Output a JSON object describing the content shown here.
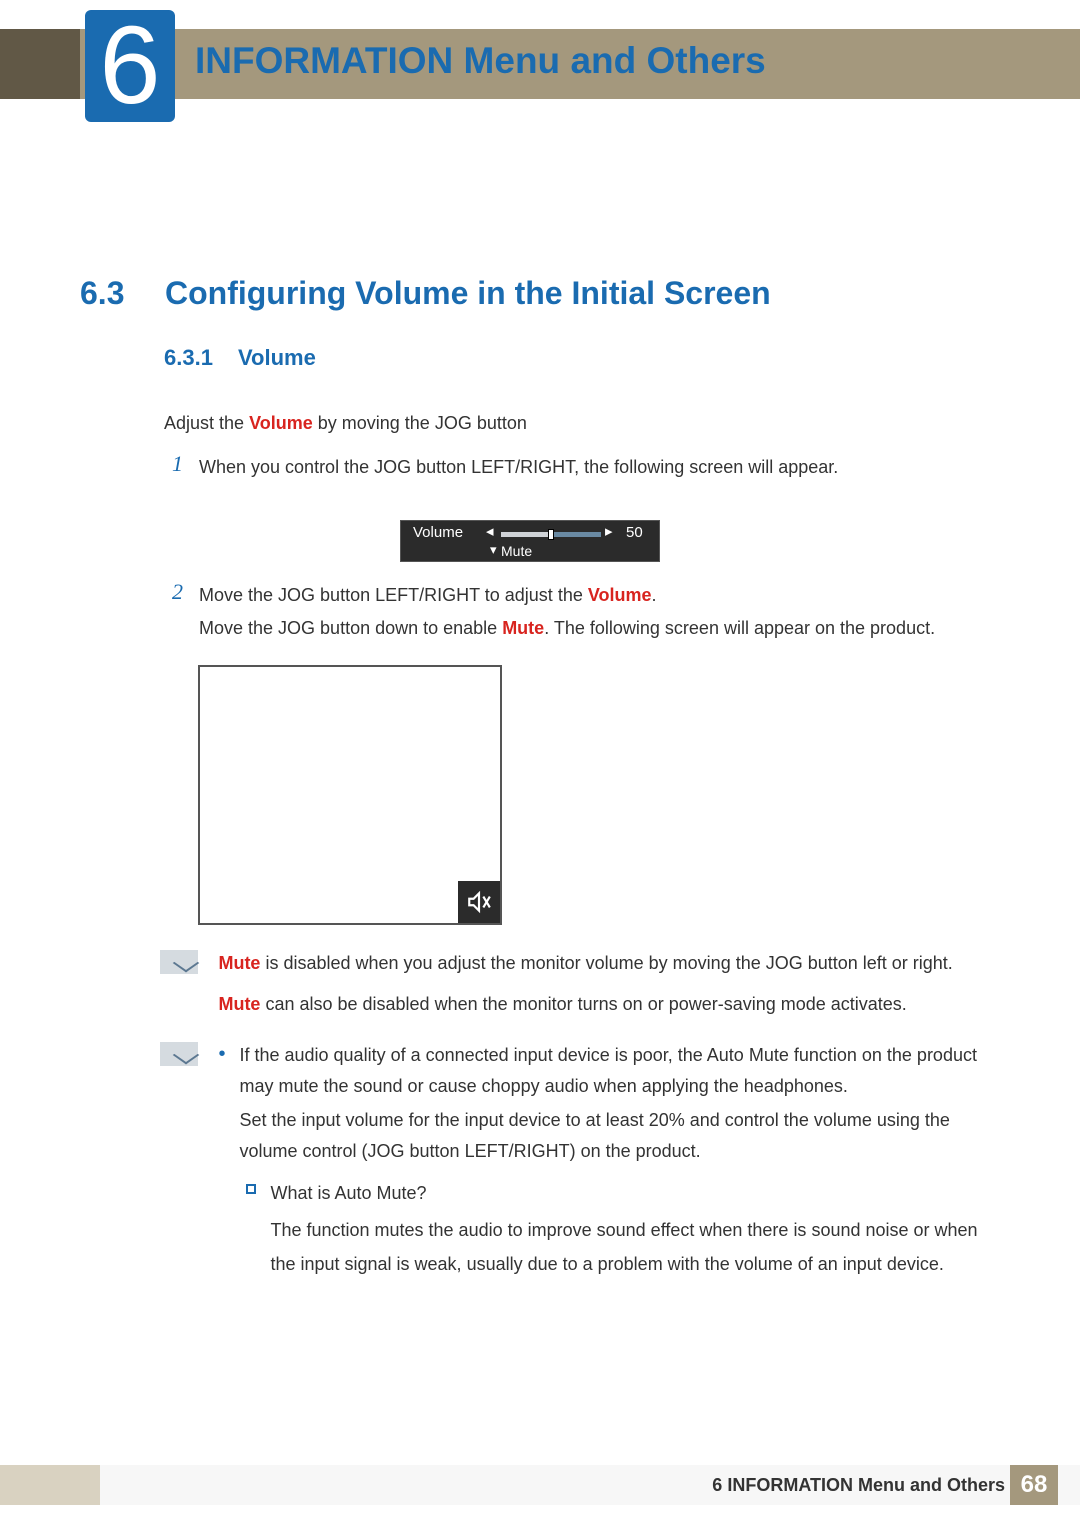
{
  "header": {
    "chapter_number": "6",
    "chapter_title": "INFORMATION Menu and Others"
  },
  "section": {
    "number": "6.3",
    "title": "Configuring Volume in the Initial Screen"
  },
  "subsection": {
    "number": "6.3.1",
    "title": "Volume"
  },
  "intro": {
    "prefix": "Adjust the ",
    "bold": "Volume",
    "suffix": " by moving the JOG button"
  },
  "steps": {
    "s1_num": "1",
    "s1_text": "When you control the JOG button LEFT/RIGHT, the following screen will appear.",
    "s2_num": "2",
    "s2a_prefix": "Move the JOG button LEFT/RIGHT to adjust the ",
    "s2a_bold": "Volume",
    "s2a_suffix": ".",
    "s2b_prefix": "Move the JOG button down to enable ",
    "s2b_bold": "Mute",
    "s2b_suffix": ". The following screen will appear on the product."
  },
  "volume_osd": {
    "label": "Volume",
    "value": "50",
    "mute_label": "Mute"
  },
  "note1": {
    "line1_bold": "Mute",
    "line1_rest": " is disabled when you adjust the monitor volume by moving the JOG button left or right.",
    "line2_bold": "Mute",
    "line2_rest": " can also be disabled when the monitor turns on or power-saving mode activates."
  },
  "note2": {
    "b1a": "If the audio quality of a connected input device is poor, the Auto Mute function on the product may mute the sound or cause choppy audio when applying the headphones.",
    "b1b": "Set the input volume for the input device to at least 20% and control the volume using the volume control (JOG button LEFT/RIGHT) on the product.",
    "sub_q": "What is Auto Mute?",
    "sub_a": "The function mutes the audio to improve sound effect when there is sound noise or when the input signal is weak, usually due to a problem with the volume of an input device."
  },
  "footer": {
    "chapter_num": "6",
    "chapter_title": "INFORMATION Menu and Others",
    "page": "68"
  }
}
